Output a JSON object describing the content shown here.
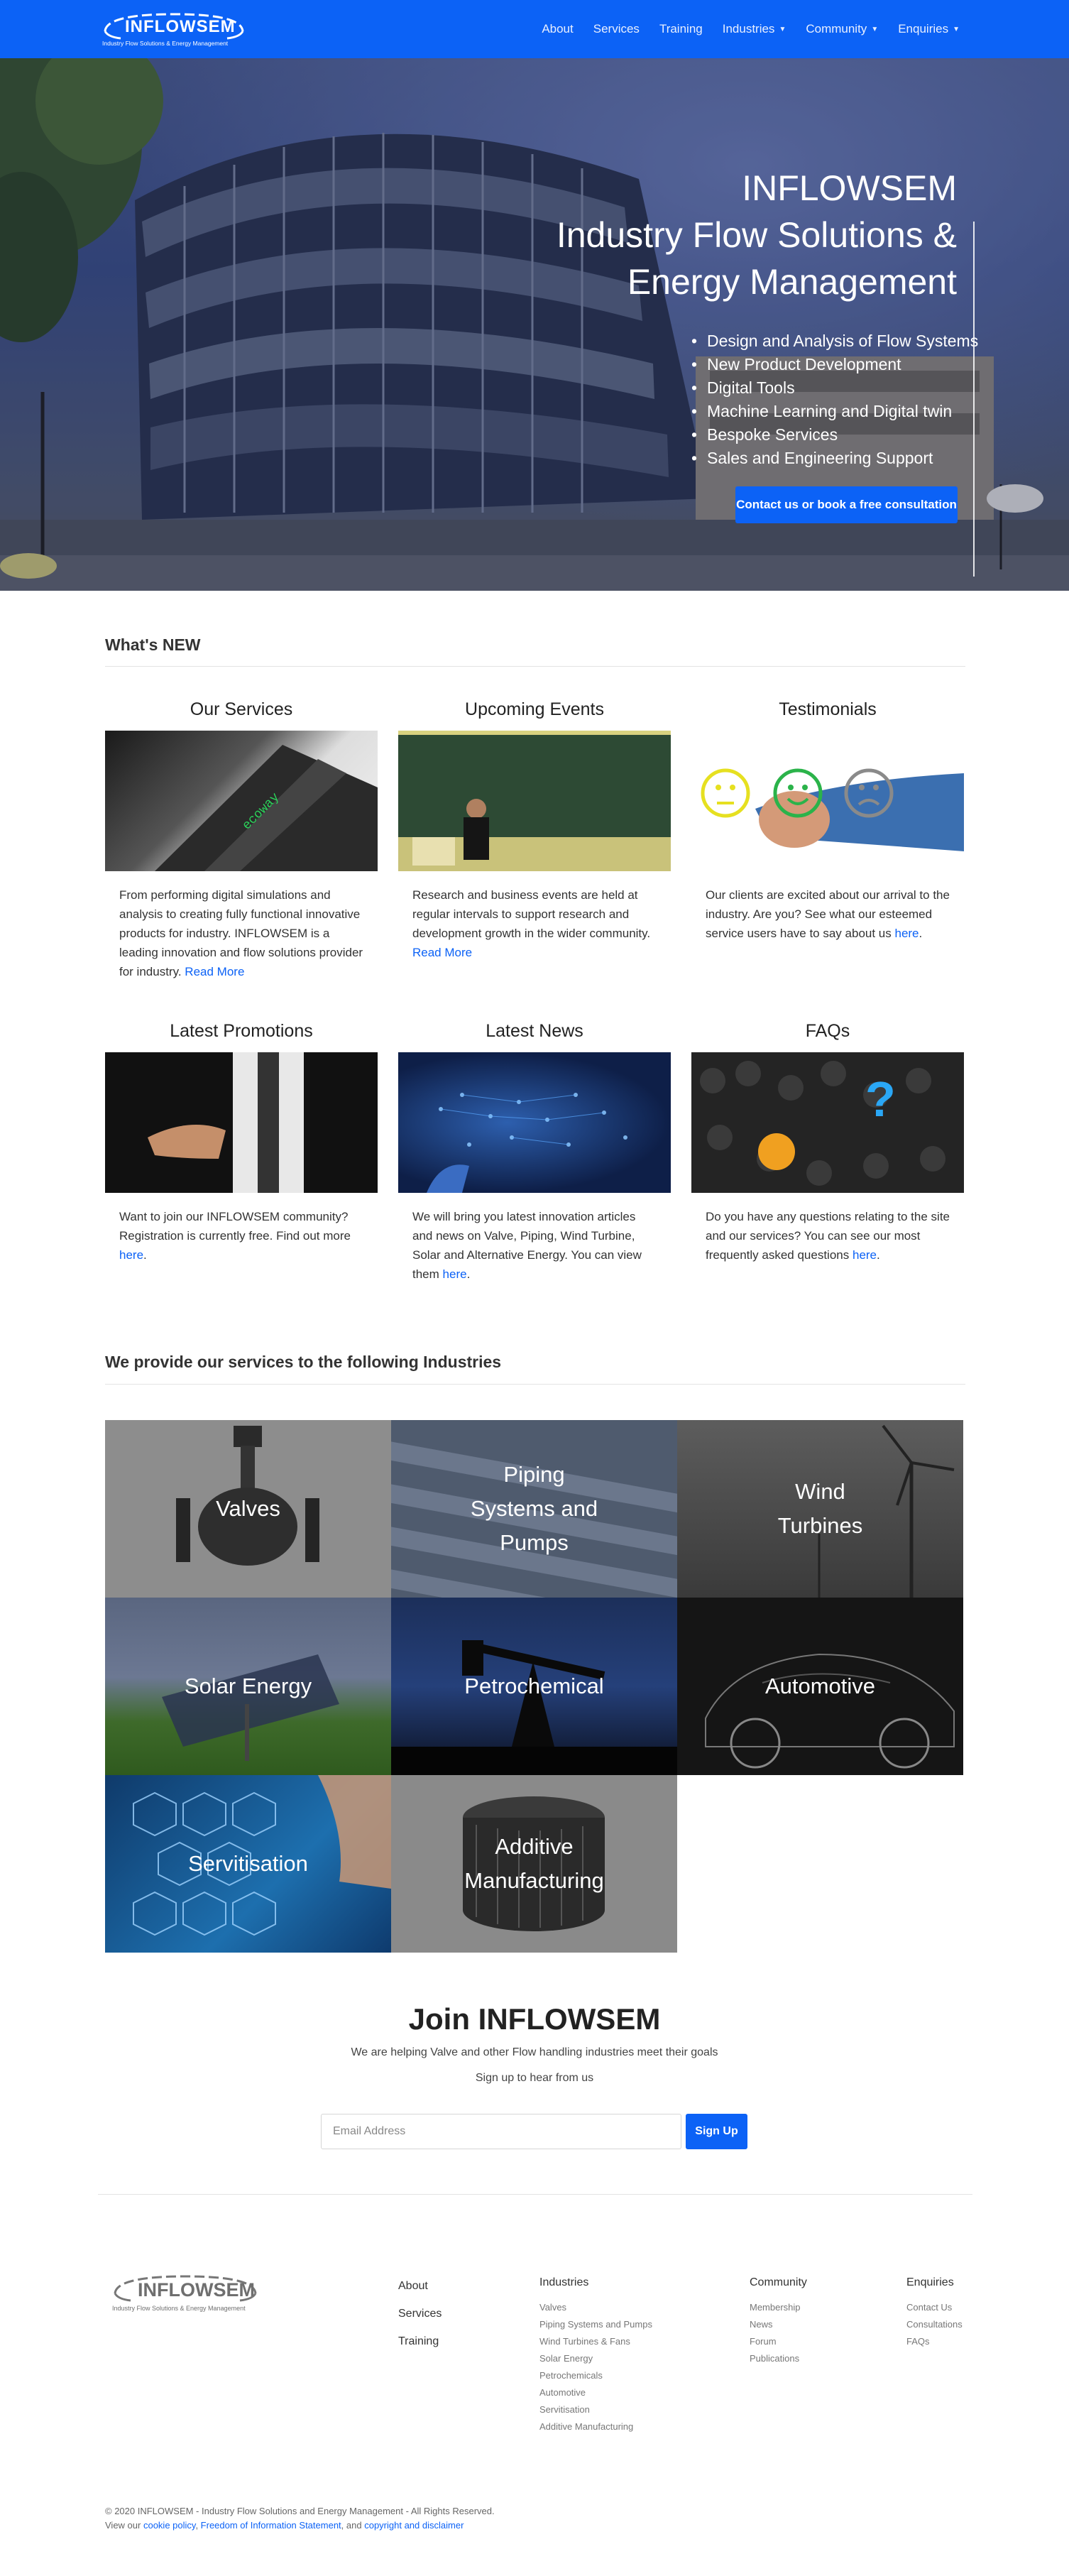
{
  "brand": {
    "name": "INFLOWSEM",
    "tagline": "Industry Flow Solutions & Energy Management"
  },
  "nav": {
    "about": "About",
    "services": "Services",
    "training": "Training",
    "industries": "Industries",
    "community": "Community",
    "enquiries": "Enquiries"
  },
  "hero": {
    "title_line1": "INFLOWSEM",
    "title_line2": "Industry Flow Solutions &",
    "title_line3": "Energy Management",
    "bullets": [
      "Design and Analysis of Flow Systems",
      "New Product Development",
      "Digital Tools",
      "Machine Learning and Digital twin",
      "Bespoke Services",
      "Sales and Engineering Support"
    ],
    "cta": "Contact us or book a free consultation"
  },
  "whats_new": {
    "title": "What's NEW",
    "cards": [
      {
        "title": "Our Services",
        "text": "From performing digital simulations and analysis to creating fully functional innovative products for industry. INFLOWSEM is a leading innovation and flow solutions provider for industry.",
        "link": "Read More"
      },
      {
        "title": "Upcoming Events",
        "text": "Research and business events are held at regular intervals to support research and development growth in the wider community.",
        "link": "Read More"
      },
      {
        "title": "Testimonials",
        "text": "Our clients are excited about our arrival to the industry. Are you? See what our esteemed service users have to say about us",
        "link": "here"
      },
      {
        "title": "Latest Promotions",
        "text": "Want to join our INFLOWSEM community? Registration is currently free. Find out more",
        "link": "here"
      },
      {
        "title": "Latest News",
        "text": "We will bring you latest innovation articles and news on Valve, Piping, Wind Turbine, Solar and Alternative Energy. You can view them",
        "link": "here"
      },
      {
        "title": "FAQs",
        "text": "Do you have any questions relating to the site and our services? You can see our most frequently asked questions",
        "link": "here"
      }
    ]
  },
  "industries": {
    "title": "We provide our services to the following Industries",
    "tiles": [
      {
        "label_lines": [
          "Valves"
        ]
      },
      {
        "label_lines": [
          "Piping",
          "Systems and",
          "Pumps"
        ]
      },
      {
        "label_lines": [
          "Wind",
          "Turbines"
        ]
      },
      {
        "label_lines": [
          "Solar Energy"
        ]
      },
      {
        "label_lines": [
          "Petrochemical"
        ]
      },
      {
        "label_lines": [
          "Automotive"
        ]
      },
      {
        "label_lines": [
          "Servitisation"
        ]
      },
      {
        "label_lines": [
          "Additive",
          "Manufacturing"
        ]
      }
    ]
  },
  "join": {
    "title": "Join INFLOWSEM",
    "subtitle": "We are helping Valve and other Flow handling industries meet their goals",
    "signup_text": "Sign up to hear from us",
    "email_placeholder": "Email Address",
    "button": "Sign Up"
  },
  "footer": {
    "main_links": [
      "About",
      "Services",
      "Training"
    ],
    "industries": {
      "heading": "Industries",
      "items": [
        "Valves",
        "Piping Systems and Pumps",
        "Wind Turbines & Fans",
        "Solar Energy",
        "Petrochemicals",
        "Automotive",
        "Servitisation",
        "Additive Manufacturing"
      ]
    },
    "community": {
      "heading": "Community",
      "items": [
        "Membership",
        "News",
        "Forum",
        "Publications"
      ]
    },
    "enquiries": {
      "heading": "Enquiries",
      "items": [
        "Contact Us",
        "Consultations",
        "FAQs"
      ]
    },
    "copyright": "© 2020 INFLOWSEM - Industry Flow Solutions and Energy Management - All Rights Reserved.",
    "view_our": "View our",
    "cookie": "cookie policy",
    "foi": "Freedom of Information Statement",
    "and": "and",
    "copyright_link": "copyright and disclaimer"
  },
  "colors": {
    "primary": "#0c62f6"
  }
}
